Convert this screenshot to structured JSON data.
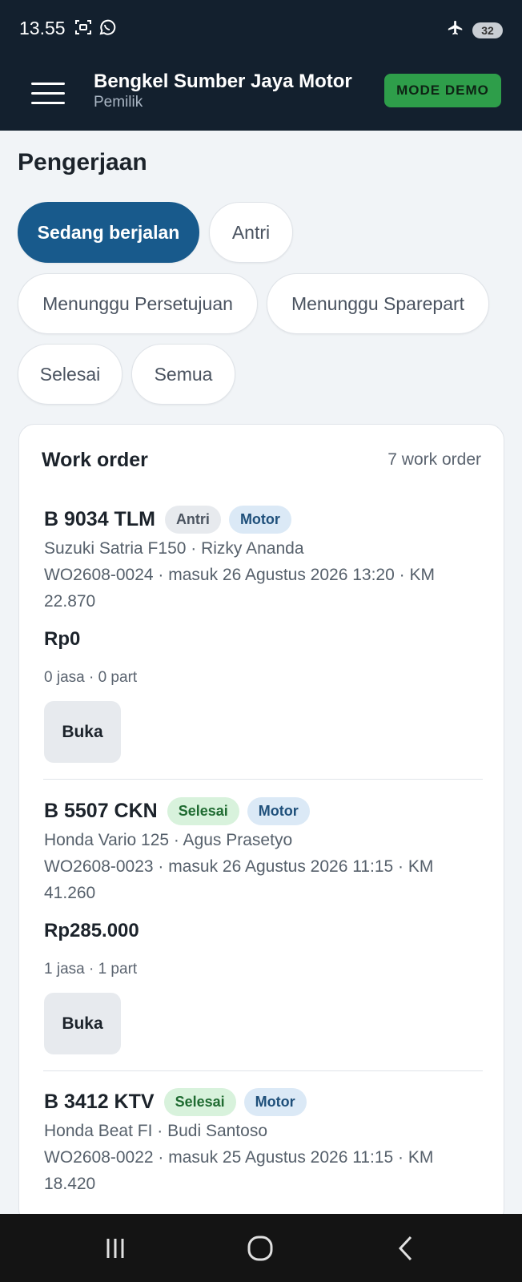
{
  "status_bar": {
    "time": "13.55",
    "battery": "32"
  },
  "app_bar": {
    "title": "Bengkel Sumber Jaya Motor",
    "subtitle": "Pemilik",
    "demo_label": "MODE DEMO"
  },
  "page": {
    "title": "Pengerjaan"
  },
  "filters": [
    {
      "label": "Sedang berjalan",
      "active": true
    },
    {
      "label": "Antri",
      "active": false
    },
    {
      "label": "Menunggu Persetujuan",
      "active": false
    },
    {
      "label": "Menunggu Sparepart",
      "active": false
    },
    {
      "label": "Selesai",
      "active": false
    },
    {
      "label": "Semua",
      "active": false
    }
  ],
  "work_orders": {
    "title": "Work order",
    "count": "7 work order",
    "items": [
      {
        "plate": "B 9034 TLM",
        "status": "Antri",
        "type": "Motor",
        "vehicle_owner": "Suzuki Satria F150 · Rizky Ananda",
        "details": "WO2608-0024 · masuk 26 Agustus 2026 13:20 · KM 22.870",
        "price": "Rp0",
        "counts": "0 jasa · 0 part",
        "open_label": "Buka"
      },
      {
        "plate": "B 5507 CKN",
        "status": "Selesai",
        "type": "Motor",
        "vehicle_owner": "Honda Vario 125 · Agus Prasetyo",
        "details": "WO2608-0023 · masuk 26 Agustus 2026 11:15 · KM 41.260",
        "price": "Rp285.000",
        "counts": "1 jasa · 1 part",
        "open_label": "Buka"
      },
      {
        "plate": "B 3412 KTV",
        "status": "Selesai",
        "type": "Motor",
        "vehicle_owner": "Honda Beat FI · Budi Santoso",
        "details": "WO2608-0022 · masuk 25 Agustus 2026 11:15 · KM 18.420"
      }
    ]
  },
  "icons": {
    "status_left": [
      "screenshot-icon",
      "whatsapp-icon"
    ],
    "status_right": [
      "airplane-icon",
      "battery-icon"
    ],
    "menu": "hamburger-menu-icon",
    "nav": [
      "recent-apps-icon",
      "home-icon",
      "back-icon"
    ]
  },
  "colors": {
    "header_bg": "#13202e",
    "accent": "#185a8c",
    "demo_green": "#2e9e4a",
    "badge_done_bg": "#d8f2dc",
    "badge_motor_bg": "#dbe9f6"
  }
}
